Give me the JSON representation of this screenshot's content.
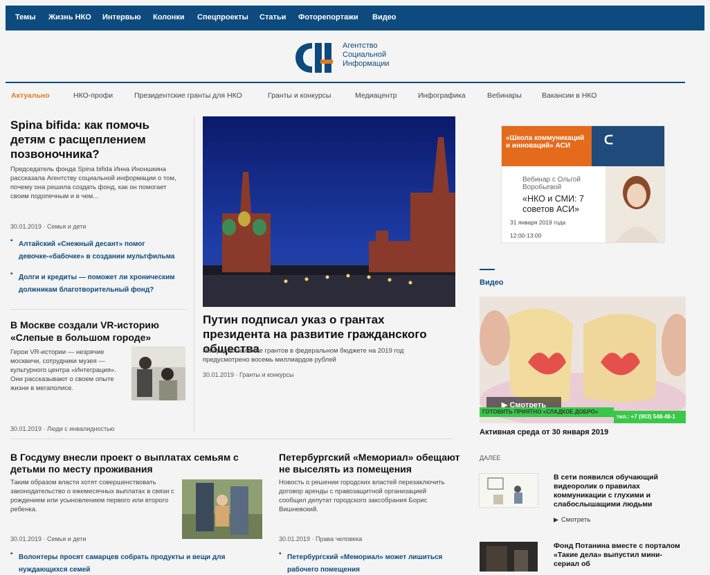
{
  "topnav": [
    "Темы",
    "Жизнь НКО",
    "Интервью",
    "Колонки",
    "Спецпроекты",
    "Статьи",
    "Фоторепортажи",
    "Видео"
  ],
  "logo": {
    "lines": [
      "Агентство",
      "Социальной",
      "Информации"
    ]
  },
  "subnav": [
    "Актуально",
    "НКО-профи",
    "Президентские гранты для НКО",
    "Гранты и конкурсы",
    "Медиацентр",
    "Инфографика",
    "Вебинары",
    "Вакансии в НКО"
  ],
  "a1": {
    "title": "Spina bifida: как помочь детям с расщеплением позвоночника?",
    "lead": "Председатель фонда Spina bifida Инна Иноншкина рассказала Агентству социальной информации о том, почему она решила создать фонд, как он помогает своим подопечным и в чем...",
    "meta": "30.01.2019 · Семья и дети",
    "related": [
      "Алтайский «Снежный десант» помог девочке-«бабочке» в создании мультфильма",
      "Долги и кредиты — поможет ли хроническим должникам благотворительный фонд?"
    ]
  },
  "a2": {
    "title": "В Москве создали VR-историю «Слепые в большом городе»",
    "lead": "Герои VR-истории — незрячие москвичи, сотрудники музея — культурного центра «Интеграция». Они рассказывают о своем опыте жизни в мегаполисе.",
    "meta": "30.01.2019 · Люди с инвалидностью"
  },
  "main": {
    "title": "Путин подписал указ о грантах президента на развитие гражданского общества",
    "lead": "На предоставление грантов в федеральном бюджете на 2019 год предусмотрено восемь миллиардов рублей",
    "meta": "30.01.2019 · Гранты и конкурсы"
  },
  "a3": {
    "title": "В Госдуму внесли проект о выплатах семьям с детьми по месту проживания",
    "lead": "Таким образом власти хотят совершенствовать законодательство о ежемесячных выплатах в связи с рождением или усыновлением первого или второго ребенка.",
    "meta": "30.01.2019 · Семья и дети",
    "related": "Волонтеры просят самарцев собрать продукты и вещи для нуждающихся семей"
  },
  "a4": {
    "title": "Петербургский «Мемориал» обещают не выселять из помещения",
    "lead": "Новость о решении городских властей перезаключить договор аренды с правозащитной организацией сообщил депутат городского заксобрания Борис Вишневский.",
    "meta": "30.01.2019 · Права человека",
    "related": "Петербургский «Мемориал» может лишиться рабочего помещения"
  },
  "banner": {
    "header": "«Школа коммуникаций и инноваций» АСИ",
    "webinar": "Вебинар с Ольгой Воробьевой",
    "topic": "«НКО и СМИ: 7 советов АСИ»",
    "date": "31 января 2019 года",
    "time": "12:00-13:00"
  },
  "video": {
    "section": "Видео",
    "button": "▶ Смотреть",
    "strip_left": "ГОТОВИТЬ ПРИЯТНО «СЛАДКОЕ ДОБРО»",
    "strip_right": "тел.: +7 (903) 548-48-1",
    "title": "Активная среда от 30 января 2019",
    "next_label": "ДАЛЕЕ",
    "items": [
      {
        "title": "В сети появился обучающий видеоролик о правилах коммуникации с глухими и слабослышащими людьми",
        "watch": "Смотреть"
      },
      {
        "title": "Фонд Потанина вместе с порталом «Такие дела» выпустил мини-сериал об"
      }
    ]
  },
  "colors": {
    "brand": "#0d4a7d",
    "accent": "#e07b1a",
    "green": "#39c84a"
  }
}
